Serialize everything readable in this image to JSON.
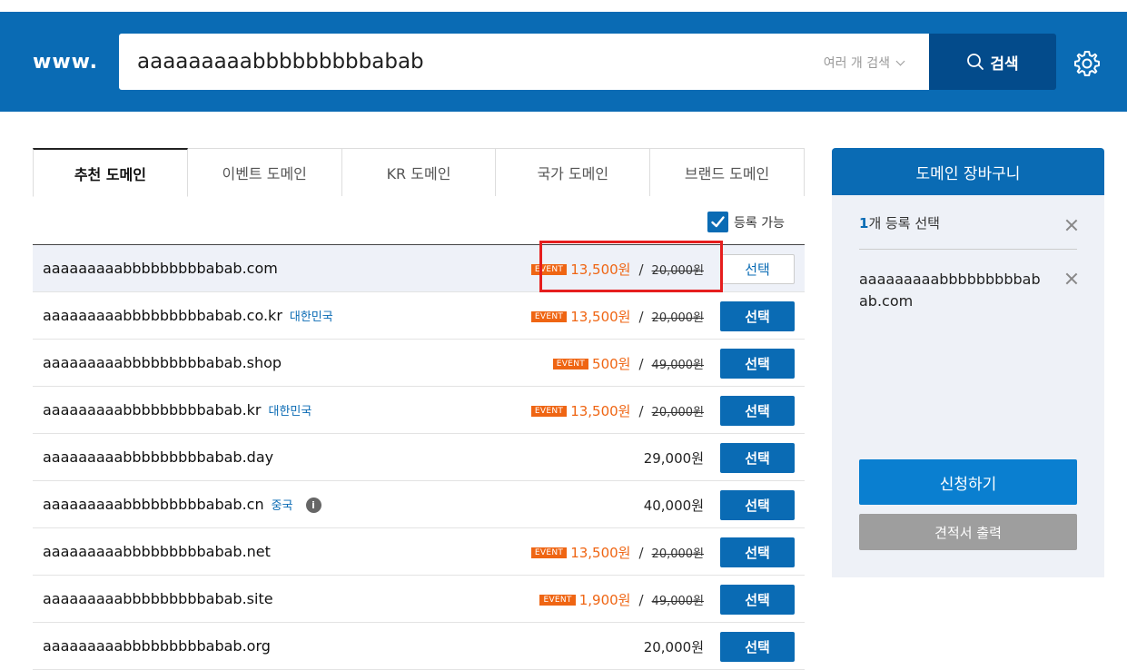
{
  "header": {
    "prefix": "www.",
    "search_value": "aaaaaaaaabbbbbbbbbabab",
    "multi_search_label": "여러 개 검색",
    "search_button_label": "검색"
  },
  "tabs": [
    {
      "label": "추천 도메인",
      "active": true
    },
    {
      "label": "이벤트 도메인",
      "active": false
    },
    {
      "label": "KR 도메인",
      "active": false
    },
    {
      "label": "국가 도메인",
      "active": false
    },
    {
      "label": "브랜드 도메인",
      "active": false
    }
  ],
  "filter": {
    "available_label": "등록 가능",
    "checked": true
  },
  "domains": [
    {
      "name": "aaaaaaaaabbbbbbbbbabab.com",
      "country": "",
      "event_badge": "EVENT",
      "sale_price": "13,500원",
      "original_price": "20,000원",
      "price": "",
      "info": "",
      "select_label": "선택",
      "selected": true
    },
    {
      "name": "aaaaaaaaabbbbbbbbbabab.co.kr",
      "country": "대한민국",
      "event_badge": "EVENT",
      "sale_price": "13,500원",
      "original_price": "20,000원",
      "price": "",
      "info": "",
      "select_label": "선택",
      "selected": false
    },
    {
      "name": "aaaaaaaaabbbbbbbbbabab.shop",
      "country": "",
      "event_badge": "EVENT",
      "sale_price": "500원",
      "original_price": "49,000원",
      "price": "",
      "info": "",
      "select_label": "선택",
      "selected": false
    },
    {
      "name": "aaaaaaaaabbbbbbbbbabab.kr",
      "country": "대한민국",
      "event_badge": "EVENT",
      "sale_price": "13,500원",
      "original_price": "20,000원",
      "price": "",
      "info": "",
      "select_label": "선택",
      "selected": false
    },
    {
      "name": "aaaaaaaaabbbbbbbbbabab.day",
      "country": "",
      "event_badge": "",
      "sale_price": "",
      "original_price": "",
      "price": "29,000원",
      "info": "",
      "select_label": "선택",
      "selected": false
    },
    {
      "name": "aaaaaaaaabbbbbbbbbabab.cn",
      "country": "중국",
      "event_badge": "",
      "sale_price": "",
      "original_price": "",
      "price": "40,000원",
      "info": "i",
      "select_label": "선택",
      "selected": false
    },
    {
      "name": "aaaaaaaaabbbbbbbbbabab.net",
      "country": "",
      "event_badge": "EVENT",
      "sale_price": "13,500원",
      "original_price": "20,000원",
      "price": "",
      "info": "",
      "select_label": "선택",
      "selected": false
    },
    {
      "name": "aaaaaaaaabbbbbbbbbabab.site",
      "country": "",
      "event_badge": "EVENT",
      "sale_price": "1,900원",
      "original_price": "49,000원",
      "price": "",
      "info": "",
      "select_label": "선택",
      "selected": false
    },
    {
      "name": "aaaaaaaaabbbbbbbbbabab.org",
      "country": "",
      "event_badge": "",
      "sale_price": "",
      "original_price": "",
      "price": "20,000원",
      "info": "",
      "select_label": "선택",
      "selected": false
    }
  ],
  "cart": {
    "title": "도메인 장바구니",
    "count": "1",
    "count_suffix": "개 등록 선택",
    "items": [
      "aaaaaaaaabbbbbbbbbabab.com"
    ],
    "apply_label": "신청하기",
    "quote_label": "견적서 출력"
  },
  "colors": {
    "brand": "#0a6bb4",
    "brand_dark": "#034b8b",
    "event": "#ef6513",
    "highlight": "#e61e1e"
  }
}
